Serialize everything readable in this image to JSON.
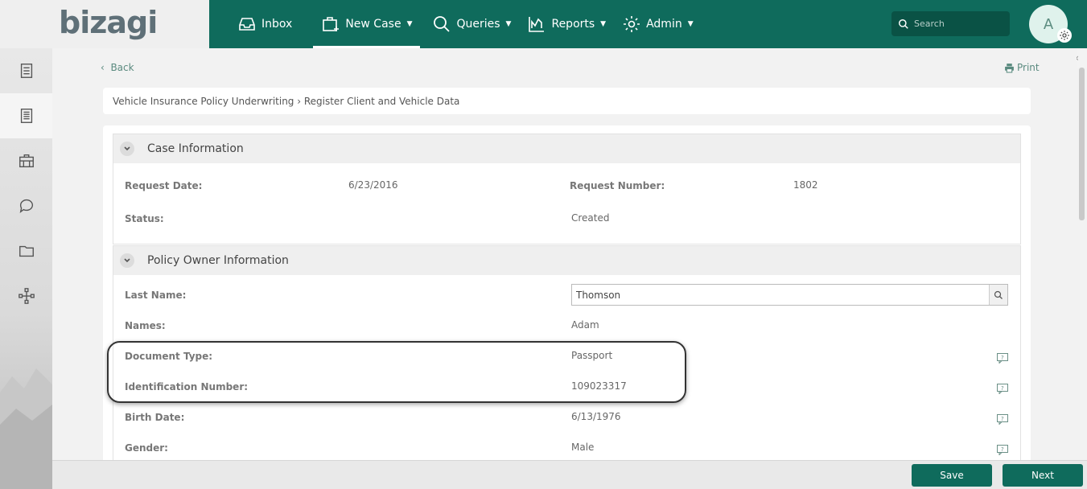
{
  "brand": {
    "logo_text": "bizagi"
  },
  "nav": [
    {
      "label": "Inbox",
      "has_caret": false
    },
    {
      "label": "New Case",
      "has_caret": true
    },
    {
      "label": "Queries",
      "has_caret": true
    },
    {
      "label": "Reports",
      "has_caret": true
    },
    {
      "label": "Admin",
      "has_caret": true
    }
  ],
  "search": {
    "placeholder": "Search"
  },
  "user": {
    "initial": "A"
  },
  "toolbar": {
    "back_label": "Back",
    "print_label": "Print"
  },
  "breadcrumb": "Vehicle Insurance Policy Underwriting › Register Client and Vehicle Data",
  "case_info": {
    "title": "Case Information",
    "request_date_label": "Request Date:",
    "request_date_value": "6/23/2016",
    "request_number_label": "Request Number:",
    "request_number_value": "1802",
    "status_label": "Status:",
    "status_value": "Created"
  },
  "policy_owner": {
    "title": "Policy Owner Information",
    "last_name_label": "Last Name:",
    "last_name_value": "Thomson",
    "names_label": "Names:",
    "names_value": "Adam",
    "doc_type_label": "Document Type:",
    "doc_type_value": "Passport",
    "id_number_label": "Identification Number:",
    "id_number_value": "109023317",
    "birth_date_label": "Birth Date:",
    "birth_date_value": "6/13/1976",
    "gender_label": "Gender:",
    "gender_value": "Male"
  },
  "actions": {
    "save_label": "Save",
    "next_label": "Next"
  },
  "colors": {
    "primary": "#0f6b5c",
    "accent_text": "#5a8a7f"
  }
}
